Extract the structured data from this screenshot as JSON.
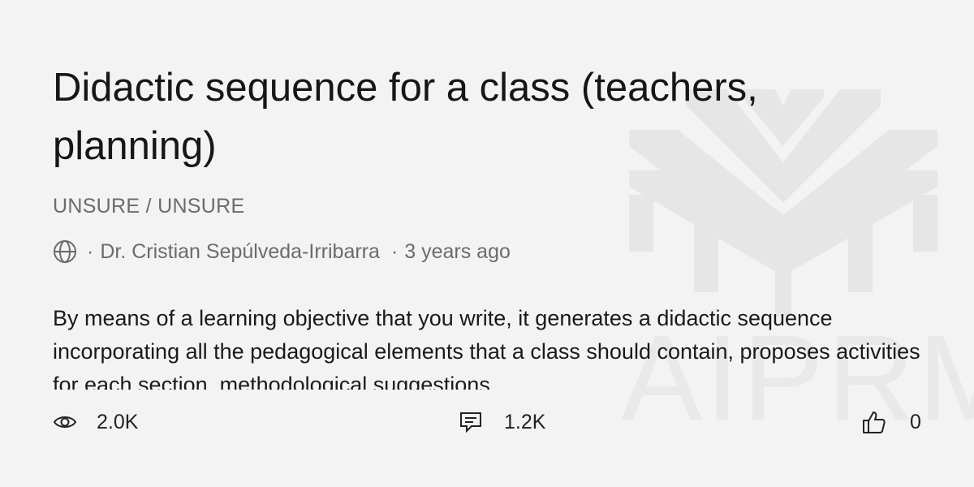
{
  "card": {
    "title": "Didactic sequence for a class (teachers, planning)",
    "category": "UNSURE / UNSURE",
    "author": "Dr. Cristian Sepúlveda-Irribarra",
    "age": "3 years ago",
    "description": "By means of a learning objective that you write, it generates a didactic sequence incorporating all the pedagogical elements that a class should contain, proposes activities for each section, methodological suggestions",
    "separator": "·"
  },
  "stats": {
    "views": "2.0K",
    "comments": "1.2K",
    "likes": "0"
  },
  "watermark": {
    "text": "AIPRM"
  },
  "icons": {
    "visibility": "globe-icon",
    "views": "eye-icon",
    "comments": "comment-icon",
    "likes": "thumbs-up-icon"
  },
  "colors": {
    "background": "#f3f3f3",
    "title": "#161616",
    "muted": "#6b6b6b",
    "watermark": "#e9e9e9"
  }
}
